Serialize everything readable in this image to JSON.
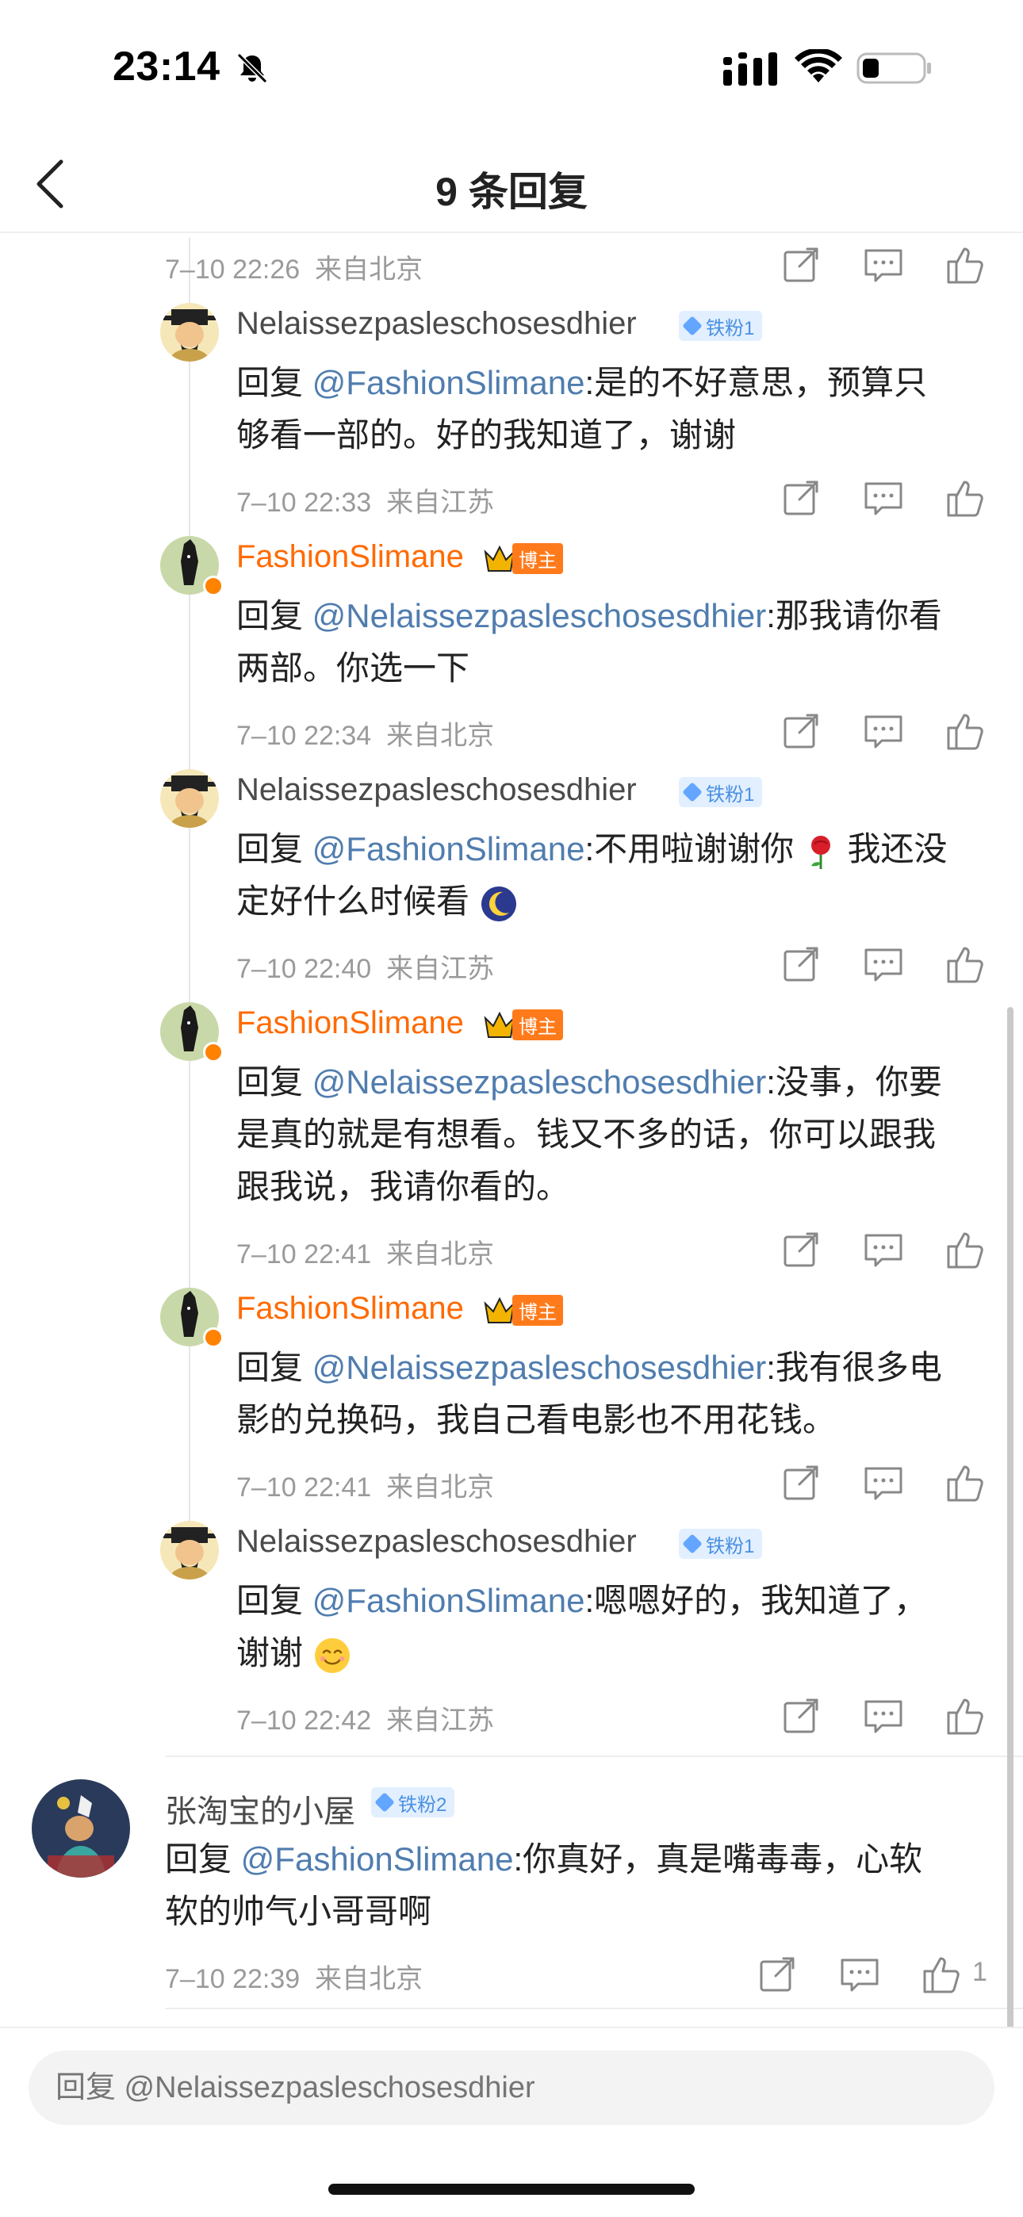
{
  "status_bar": {
    "time": "23:14"
  },
  "nav": {
    "title": "9 条回复"
  },
  "top_meta": {
    "time": "7–10 22:26",
    "location": "来自北京"
  },
  "replies": [
    {
      "name": "Nelaissezpasleschosesdhier",
      "fan_badge": "铁粉1",
      "reply_prefix": "回复 ",
      "mention": "@FashionSlimane",
      "text_line1": ":是的不好意思，预算只",
      "text_line2": "够看一部的。好的我知道了，谢谢",
      "time": "7–10 22:33",
      "location": "来自江苏"
    },
    {
      "name": "FashionSlimane",
      "blogger_tag": "博主",
      "reply_prefix": "回复 ",
      "mention": "@Nelaissezpasleschosesdhier",
      "text_line1": ":那我请你看",
      "text_line2": "两部。你选一下",
      "time": "7–10 22:34",
      "location": "来自北京"
    },
    {
      "name": "Nelaissezpasleschosesdhier",
      "fan_badge": "铁粉1",
      "reply_prefix": "回复 ",
      "mention": "@FashionSlimane",
      "text_line1": ":不用啦谢谢你",
      "text_line1b": "我还没",
      "text_line2": "定好什么时候看",
      "time": "7–10 22:40",
      "location": "来自江苏"
    },
    {
      "name": "FashionSlimane",
      "blogger_tag": "博主",
      "reply_prefix": "回复 ",
      "mention": "@Nelaissezpasleschosesdhier",
      "text_line1": ":没事，你要",
      "text_line2": "是真的就是有想看。钱又不多的话，你可以跟我",
      "text_line3": "跟我说，我请你看的。",
      "time": "7–10 22:41",
      "location": "来自北京"
    },
    {
      "name": "FashionSlimane",
      "blogger_tag": "博主",
      "reply_prefix": "回复 ",
      "mention": "@Nelaissezpasleschosesdhier",
      "text_line1": ":我有很多电",
      "text_line2": "影的兑换码，我自己看电影也不用花钱。",
      "time": "7–10 22:41",
      "location": "来自北京"
    },
    {
      "name": "Nelaissezpasleschosesdhier",
      "fan_badge": "铁粉1",
      "reply_prefix": "回复 ",
      "mention": "@FashionSlimane",
      "text_line1": ":嗯嗯好的，我知道了，",
      "text_line2": "谢谢",
      "time": "7–10 22:42",
      "location": "来自江苏"
    }
  ],
  "top_level_reply": {
    "name": "张淘宝的小屋",
    "fan_badge": "铁粉2",
    "reply_prefix": "回复 ",
    "mention": "@FashionSlimane",
    "text_line1": ":你真好，真是嘴毒毒，心软",
    "text_line2": "软的帅气小哥哥啊",
    "time": "7–10 22:39",
    "location": "来自北京",
    "like_count": "1"
  },
  "input": {
    "placeholder": "回复 @Nelaissezpasleschosesdhier"
  },
  "icons": {
    "share": "share-icon",
    "comment": "comment-icon",
    "like": "thumbs-up-icon"
  },
  "colors": {
    "mention": "#507daf",
    "blogger_name": "#ff6a00",
    "meta": "#9a9a9a",
    "fan_badge_bg": "#e2efff"
  }
}
